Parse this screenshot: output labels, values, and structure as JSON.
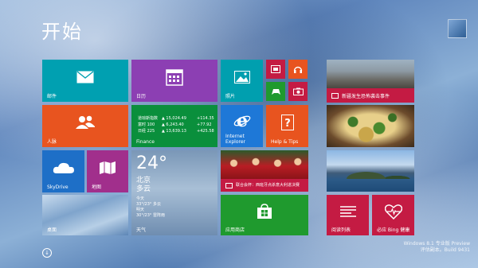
{
  "start_title": "开始",
  "tiles": {
    "mail": {
      "label": "邮件",
      "color": "#00A0B1"
    },
    "calendar": {
      "label": "日历",
      "color": "#8C3FB3"
    },
    "photos": {
      "label": "照片",
      "color": "#009FAF"
    },
    "video": {
      "color": "#C41B43"
    },
    "music": {
      "color": "#E8541F"
    },
    "games": {
      "color": "#1F9A2E"
    },
    "camera": {
      "color": "#C41B43"
    },
    "people": {
      "label": "人脉",
      "color": "#E8541F"
    },
    "finance": {
      "label": "Finance",
      "color": "#0A8F3C",
      "rows": [
        {
          "name": "道琼斯指数",
          "value": "▲ 15,024.49",
          "change": "+114.35"
        },
        {
          "name": "富时 100",
          "value": "▲ 6,243.40",
          "change": "+77.92"
        },
        {
          "name": "日经 225",
          "value": "▲ 13,639.13",
          "change": "+425.58"
        }
      ]
    },
    "ie": {
      "label": "Internet Explorer",
      "color": "#1E78D7"
    },
    "help": {
      "label": "Help & Tips",
      "color": "#E8541F"
    },
    "skydrive": {
      "label": "SkyDrive",
      "color": "#1E6FC7"
    },
    "maps": {
      "label": "地图",
      "color": "#A12F8C"
    },
    "weather": {
      "label": "天气",
      "temp": "24°",
      "city": "北京",
      "condition": "多云",
      "today_label": "今天",
      "today_forecast": "33°/23° 多云",
      "tomorrow_label": "明天",
      "tomorrow_forecast": "30°/23° 雷阵雨"
    },
    "sports": {
      "caption": "联合会杯：西班牙点杀意大利进决赛",
      "color": "#C41B43"
    },
    "desktop": {
      "label": "桌面"
    },
    "store": {
      "label": "应用商店",
      "color": "#1F9A2E"
    },
    "news": {
      "caption": "新疆发生恐怖袭击事件",
      "color": "#C41B43"
    },
    "reading": {
      "label": "阅读列表",
      "color": "#C41B43"
    },
    "health": {
      "label": "必应 Bing 健康",
      "color": "#C41B43"
    }
  },
  "watermark": {
    "line1": "Windows 8.1 专业版 Preview",
    "line2": "评估副本。Build 9431"
  },
  "icons": [
    "mail-icon",
    "calendar-icon",
    "photos-icon",
    "video-icon",
    "music-icon",
    "games-icon",
    "camera-icon",
    "people-icon",
    "ie-icon",
    "help-icon",
    "skydrive-icon",
    "maps-icon",
    "store-icon",
    "reading-list-icon",
    "health-icon",
    "arrow-down-icon"
  ]
}
